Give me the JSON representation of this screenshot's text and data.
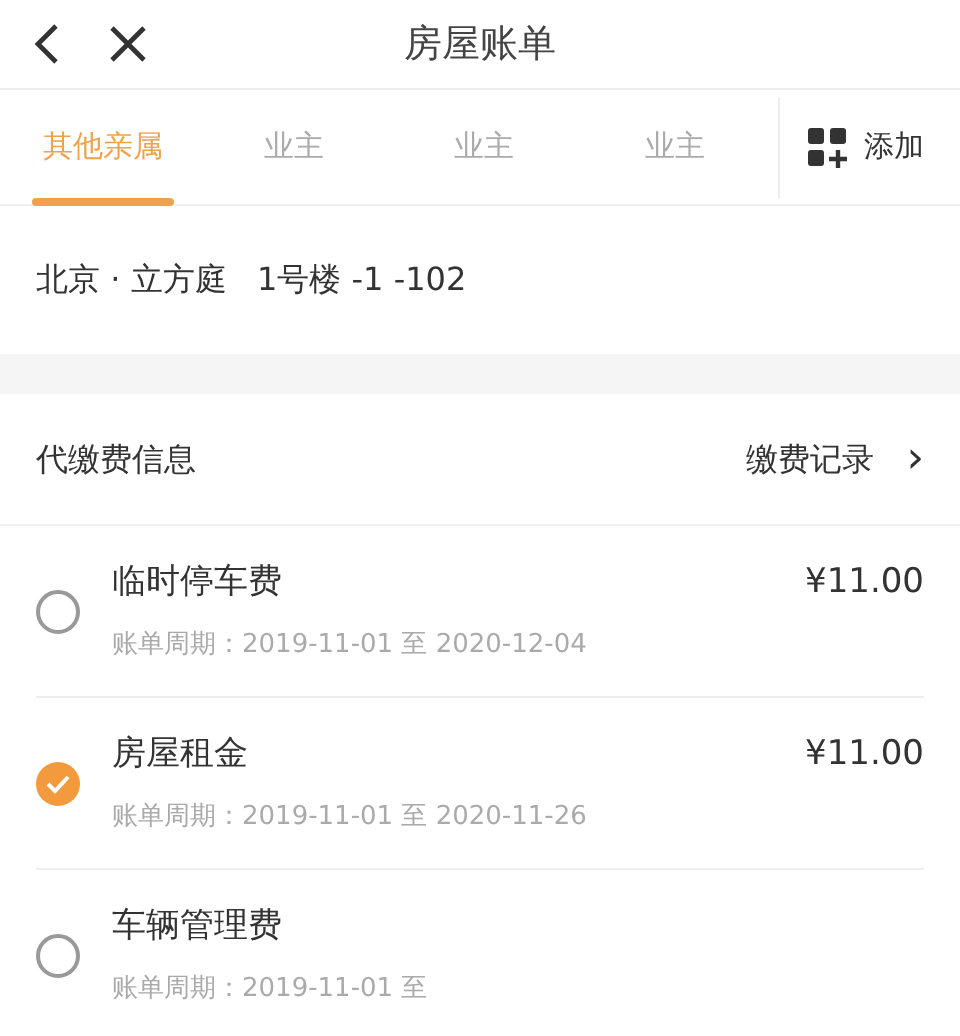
{
  "header": {
    "title": "房屋账单"
  },
  "tabs": [
    {
      "label": "其他亲属",
      "selected": true
    },
    {
      "label": "业主",
      "selected": false
    },
    {
      "label": "业主",
      "selected": false
    },
    {
      "label": "业主",
      "selected": false
    }
  ],
  "add_button": {
    "label": "添加"
  },
  "address": "北京 · 立方庭   1号楼 -1 -102",
  "section": {
    "title": "代缴费信息",
    "link": "缴费记录",
    "chevron": "›"
  },
  "bills": [
    {
      "name": "临时停车费",
      "period": "账单周期：2019-11-01 至 2020-12-04",
      "amount": "¥11.00",
      "checked": false
    },
    {
      "name": "房屋租金",
      "period": "账单周期：2019-11-01 至 2020-11-26",
      "amount": "¥11.00",
      "checked": true
    },
    {
      "name": "车辆管理费",
      "period": "账单周期：2019-11-01 至",
      "checked": false
    }
  ]
}
